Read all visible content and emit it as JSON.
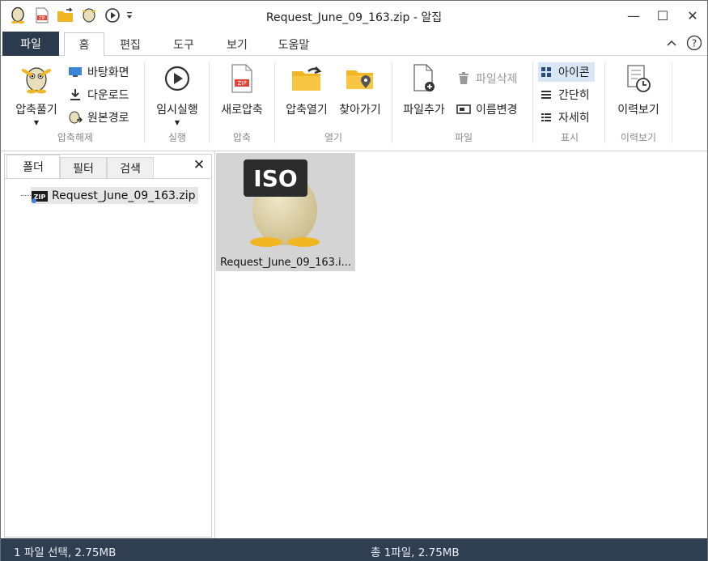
{
  "window": {
    "title": "Request_June_09_163.zip - 알집",
    "controls": {
      "minimize": "—",
      "maximize": "☐",
      "close": "✕"
    }
  },
  "qat_icons": [
    "alzip-egg-icon",
    "new-zip-icon",
    "open-folder-icon",
    "extract-egg-icon",
    "run-icon",
    "qat-dropdown-icon"
  ],
  "tabs": [
    {
      "label": "파일"
    },
    {
      "label": "홈"
    },
    {
      "label": "편집"
    },
    {
      "label": "도구"
    },
    {
      "label": "보기"
    },
    {
      "label": "도움말"
    }
  ],
  "ribbon": {
    "extract_group": {
      "label": "압축해제",
      "extract_button": "압축풀기",
      "desktop": "바탕화면",
      "download": "다운로드",
      "original_path": "원본경로"
    },
    "run_group": {
      "label": "실행",
      "run_button": "임시실행"
    },
    "compress_group": {
      "label": "압축",
      "new_button": "새로압축"
    },
    "open_group": {
      "label": "열기",
      "open_button": "압축열기",
      "find_button": "찾아가기"
    },
    "file_group": {
      "label": "파일",
      "add_button": "파일추가",
      "delete": "파일삭제",
      "rename": "이름변경"
    },
    "view_group": {
      "label": "표시",
      "icon": "아이콘",
      "simple": "간단히",
      "detail": "자세히"
    },
    "history_group": {
      "label": "이력보기",
      "history_button": "이력보기"
    }
  },
  "left_panel": {
    "tabs": [
      "폴더",
      "필터",
      "검색"
    ],
    "close": "✕",
    "tree_item": "Request_June_09_163.zip"
  },
  "file_list": {
    "items": [
      {
        "name": "Request_June_09_163.i...",
        "badge": "ISO"
      }
    ]
  },
  "status": {
    "left": "1 파일 선택,  2.75MB",
    "middle": "총 1파일,  2.75MB"
  },
  "colors": {
    "file_tab_bg": "#2b3a4d",
    "statusbar_bg": "#2f3e51",
    "folder_yellow": "#f2b624",
    "selected_bg": "#d8e6f6"
  }
}
